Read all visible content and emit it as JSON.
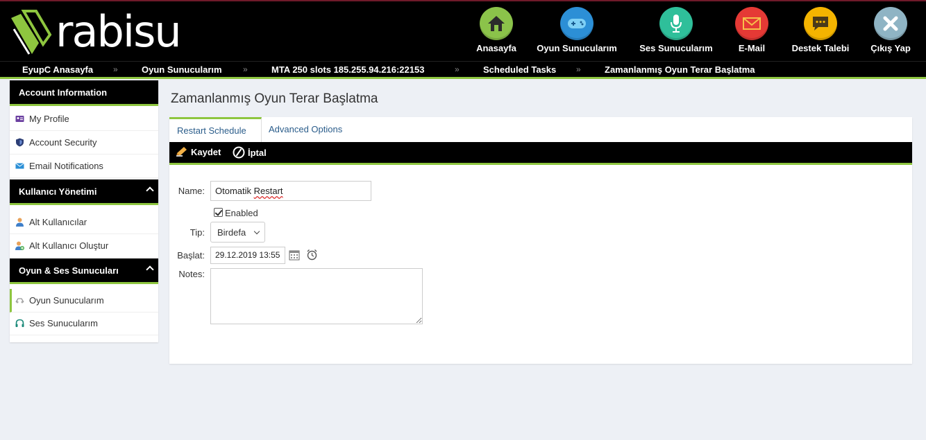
{
  "brand": {
    "logo_text": "rabisu",
    "accent": "#8ec63f"
  },
  "top_nav": [
    {
      "label": "Anasayfa",
      "icon": "home-icon",
      "color": "#8bc34a"
    },
    {
      "label": "Oyun Sunucularım",
      "icon": "gamepad-icon",
      "color": "#2c8fd6"
    },
    {
      "label": "Ses Sunucularım",
      "icon": "microphone-icon",
      "color": "#2fbf9a"
    },
    {
      "label": "E-Mail",
      "icon": "envelope-icon",
      "color": "#e53935"
    },
    {
      "label": "Destek Talebi",
      "icon": "chat-icon",
      "color": "#f4b400"
    },
    {
      "label": "Çıkış Yap",
      "icon": "close-icon",
      "color": "#8fb4c4"
    }
  ],
  "breadcrumb": [
    "EyupC Anasayfa",
    "Oyun Sunucularım",
    "MTA 250 slots 185.255.94.216:22153",
    "Scheduled Tasks",
    "Zamanlanmış Oyun Terar Başlatma"
  ],
  "breadcrumb_separator": "»",
  "sidebar": {
    "sections": [
      {
        "title": "Account Information",
        "items": [
          {
            "label": "My Profile",
            "icon": "id-card-icon"
          },
          {
            "label": "Account Security",
            "icon": "shield-icon"
          },
          {
            "label": "Email Notifications",
            "icon": "envelope-icon"
          }
        ]
      },
      {
        "title": "Kullanıcı Yönetimi",
        "items": [
          {
            "label": "Alt Kullanıcılar",
            "icon": "user-icon"
          },
          {
            "label": "Alt Kullanıcı Oluştur",
            "icon": "user-add-icon"
          }
        ]
      },
      {
        "title": "Oyun & Ses Sunucuları",
        "items": [
          {
            "label": "Oyun Sunucularım",
            "icon": "gamepad-icon",
            "active": true
          },
          {
            "label": "Ses Sunucularım",
            "icon": "headset-icon"
          }
        ]
      }
    ]
  },
  "main": {
    "title": "Zamanlanmış Oyun Terar Başlatma",
    "tabs": [
      {
        "label": "Restart Schedule",
        "active": true
      },
      {
        "label": "Advanced Options",
        "active": false
      }
    ],
    "toolbar": {
      "save_label": "Kaydet",
      "cancel_label": "İptal"
    },
    "form": {
      "name_label": "Name:",
      "name_value_plain": "Otomatik ",
      "name_value_flagged": "Restart",
      "enabled_label": "Enabled",
      "enabled_checked": true,
      "type_label": "Tip:",
      "type_value": "Birdefa",
      "start_label": "Başlat:",
      "start_value": "29.12.2019 13:55",
      "notes_label": "Notes:",
      "notes_value": ""
    }
  }
}
